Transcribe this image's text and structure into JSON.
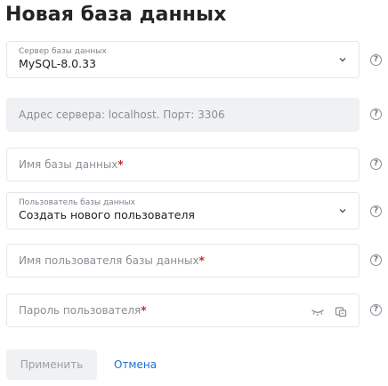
{
  "page": {
    "title": "Новая база данных"
  },
  "fields": {
    "server": {
      "label": "Сервер базы данных",
      "value": "MySQL-8.0.33"
    },
    "address": {
      "placeholder": "Адрес сервера: localhost. Порт: 3306"
    },
    "db_name": {
      "placeholder": "Имя базы данных",
      "required_mark": "*"
    },
    "db_user": {
      "label": "Пользователь базы данных",
      "value": "Создать нового пользователя"
    },
    "username": {
      "placeholder": "Имя пользователя базы данных",
      "required_mark": "*"
    },
    "password": {
      "placeholder": "Пароль пользователя",
      "required_mark": "*"
    }
  },
  "help_glyph": "?",
  "buttons": {
    "apply": "Применить",
    "cancel": "Отмена"
  },
  "icons": [
    "chevron-down-icon",
    "help-icon",
    "eye-closed-icon",
    "generate-password-icon"
  ],
  "colors": {
    "link": "#1b6ed6",
    "required": "#c62828",
    "disabled_bg": "#f0f1f3"
  }
}
